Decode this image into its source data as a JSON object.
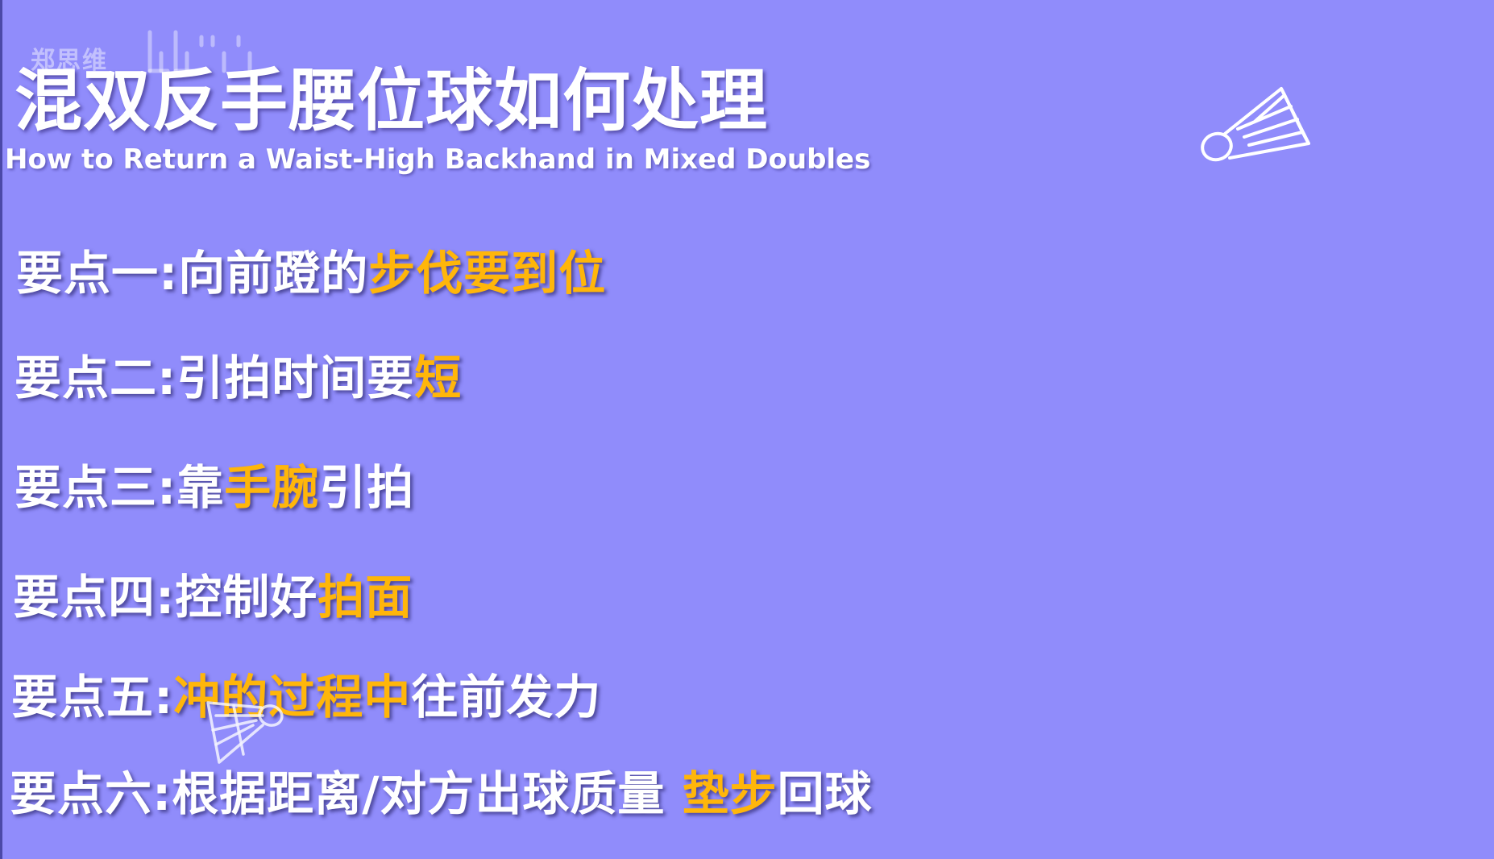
{
  "watermark": {
    "text": "郑思维"
  },
  "title": {
    "cn": "混双反手腰位球如何处理",
    "en": "How to Return a Waist-High Backhand in Mixed Doubles"
  },
  "points": [
    {
      "prefix": "要点一:",
      "parts": [
        {
          "t": "向前蹬的",
          "hl": false
        },
        {
          "t": "步伐要到位",
          "hl": true
        }
      ]
    },
    {
      "prefix": "要点二:",
      "parts": [
        {
          "t": "引拍时间要",
          "hl": false
        },
        {
          "t": "短",
          "hl": true
        }
      ]
    },
    {
      "prefix": "要点三:",
      "parts": [
        {
          "t": "靠",
          "hl": false
        },
        {
          "t": "手腕",
          "hl": true
        },
        {
          "t": "引拍",
          "hl": false
        }
      ]
    },
    {
      "prefix": "要点四:",
      "parts": [
        {
          "t": "控制好",
          "hl": false
        },
        {
          "t": "拍面",
          "hl": true
        }
      ]
    },
    {
      "prefix": "要点五:",
      "parts": [
        {
          "t": "冲的过程中",
          "hl": true
        },
        {
          "t": "往前发力",
          "hl": false
        }
      ]
    },
    {
      "prefix": "要点六:",
      "parts": [
        {
          "t": "根据距离/对方出球质量 ",
          "hl": false
        },
        {
          "t": "垫步",
          "hl": true
        },
        {
          "t": "回球",
          "hl": false
        }
      ]
    }
  ],
  "icons": {
    "top": "shuttlecock-icon",
    "middle": "shuttlecock-icon"
  },
  "colors": {
    "background": "#908cfb",
    "highlight": "#ffb60a",
    "text": "#ffffff"
  }
}
